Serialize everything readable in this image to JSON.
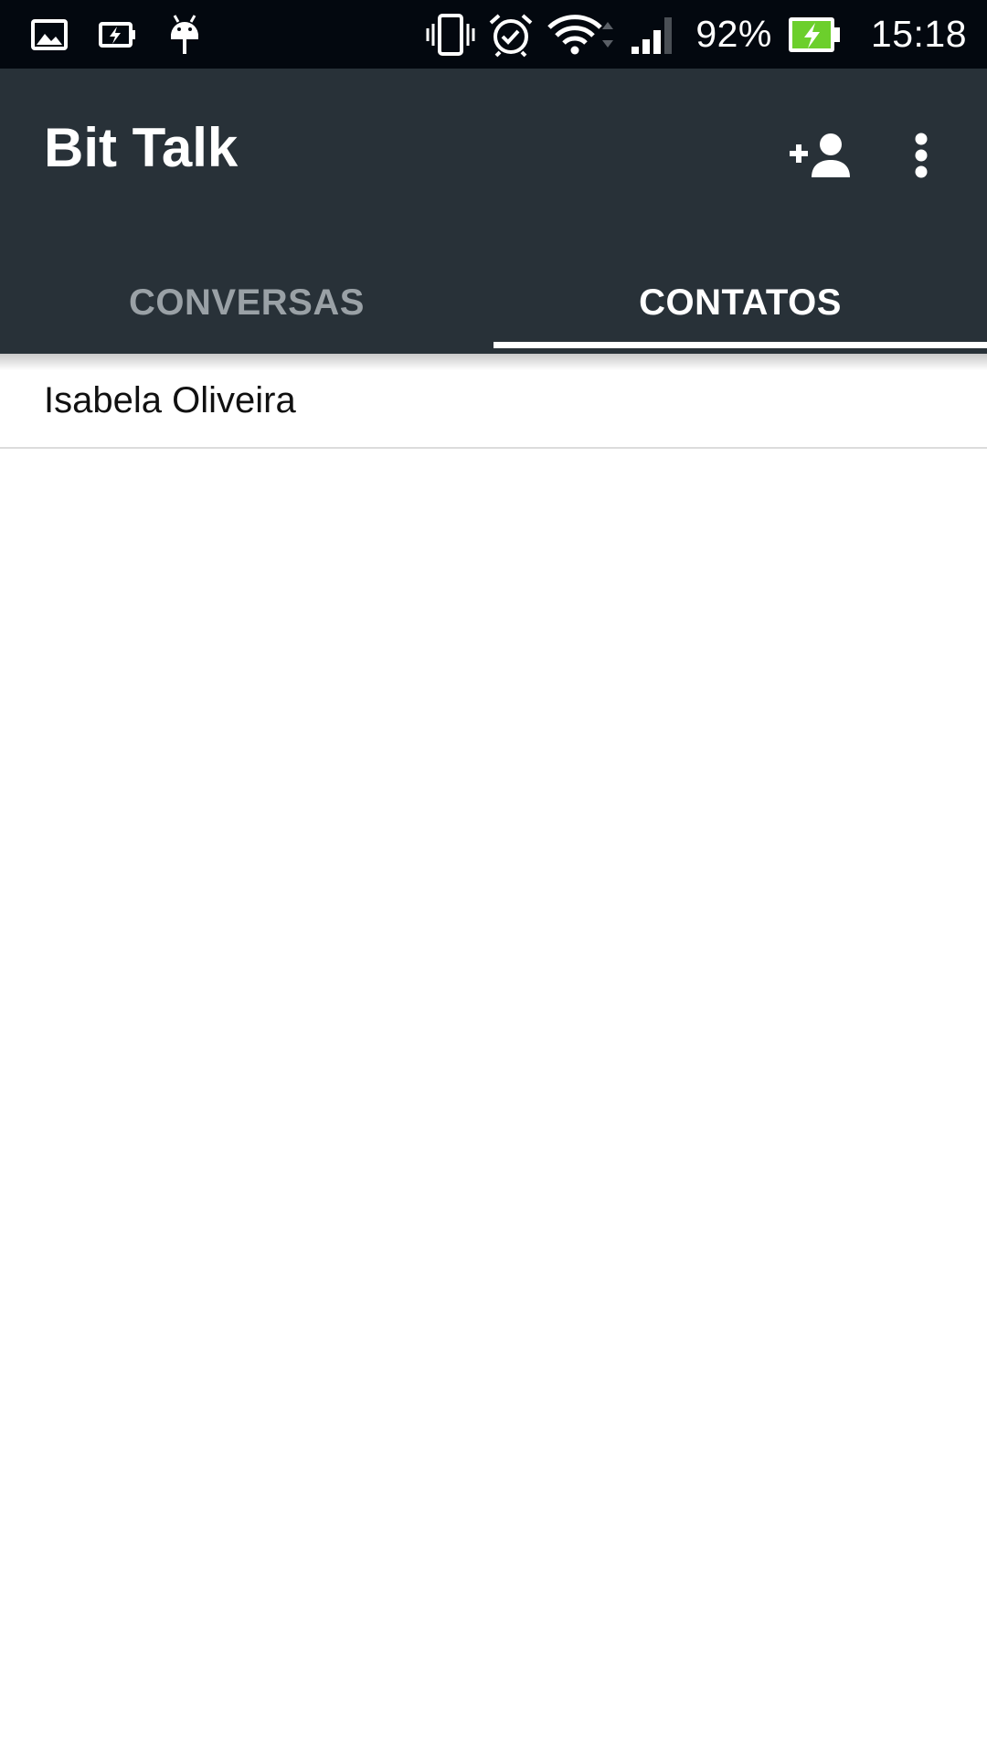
{
  "status_bar": {
    "icons_left": [
      "gallery-icon",
      "battery-saver-icon",
      "android-debug-icon"
    ],
    "icons_right": [
      "vibrate-icon",
      "alarm-icon",
      "wifi-icon",
      "cell-signal-icon"
    ],
    "battery_percent": "92%",
    "battery_icon": "battery-charging-icon",
    "battery_color": "#6ccf2c",
    "time": "15:18"
  },
  "app_bar": {
    "title": "Bit Talk",
    "background_color": "#283138",
    "actions": [
      "add-contact-icon",
      "more-vert-icon"
    ]
  },
  "tabs": [
    {
      "label": "CONVERSAS",
      "active": false
    },
    {
      "label": "CONTATOS",
      "active": true
    }
  ],
  "contacts": [
    {
      "name": "Isabela Oliveira"
    }
  ]
}
